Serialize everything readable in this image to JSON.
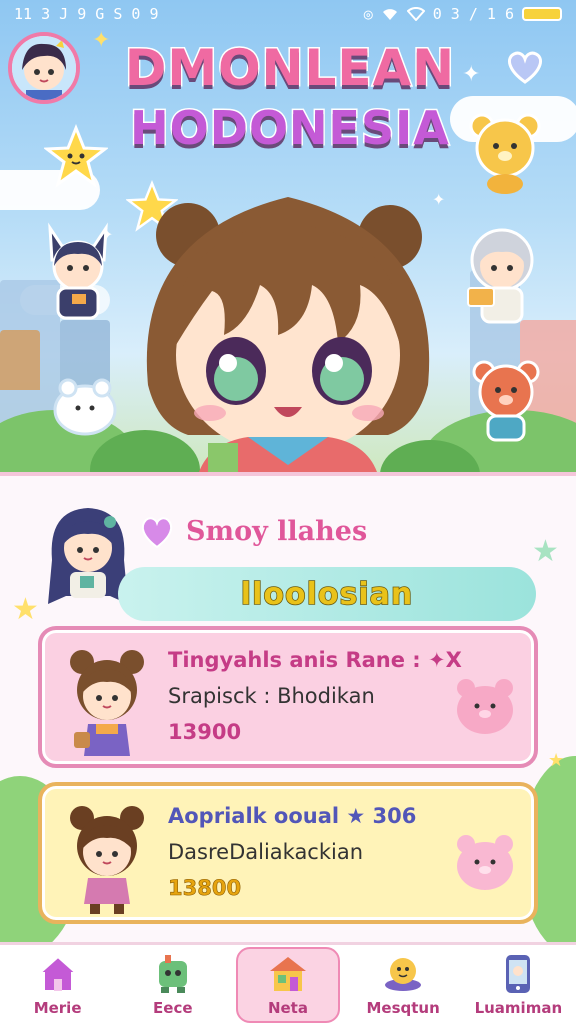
{
  "status_bar": {
    "time": "11 3 J 9 G S 0 9",
    "right_text": "0 3 / 1 6"
  },
  "header": {
    "title_line1": "DMONLEAN",
    "title_line2": "HODONESIA"
  },
  "profile": {
    "name": "Smoy llahes",
    "tag": "lloolosian"
  },
  "cards": [
    {
      "title": "Tingyahls anis Rane : ✦X",
      "subtitle": "Srapisck : Bhodikan",
      "value": "13900",
      "theme": "pink"
    },
    {
      "title": "Aoprialk ooual ★ 306",
      "subtitle": "DasreDaliakackian",
      "value": "13800",
      "theme": "yellow"
    }
  ],
  "nav": {
    "items": [
      {
        "label": "Merie",
        "icon": "house-icon"
      },
      {
        "label": "Eece",
        "icon": "robot-icon"
      },
      {
        "label": "Neta",
        "icon": "home-store-icon",
        "active": true
      },
      {
        "label": "Mesqtun",
        "icon": "bee-icon"
      },
      {
        "label": "Luamiman",
        "icon": "phone-icon"
      }
    ]
  },
  "colors": {
    "accent_pink": "#ef6aa2",
    "accent_teal": "#9be3dc",
    "card_pink": "#fbd0e2",
    "card_yellow": "#fff3b8"
  }
}
